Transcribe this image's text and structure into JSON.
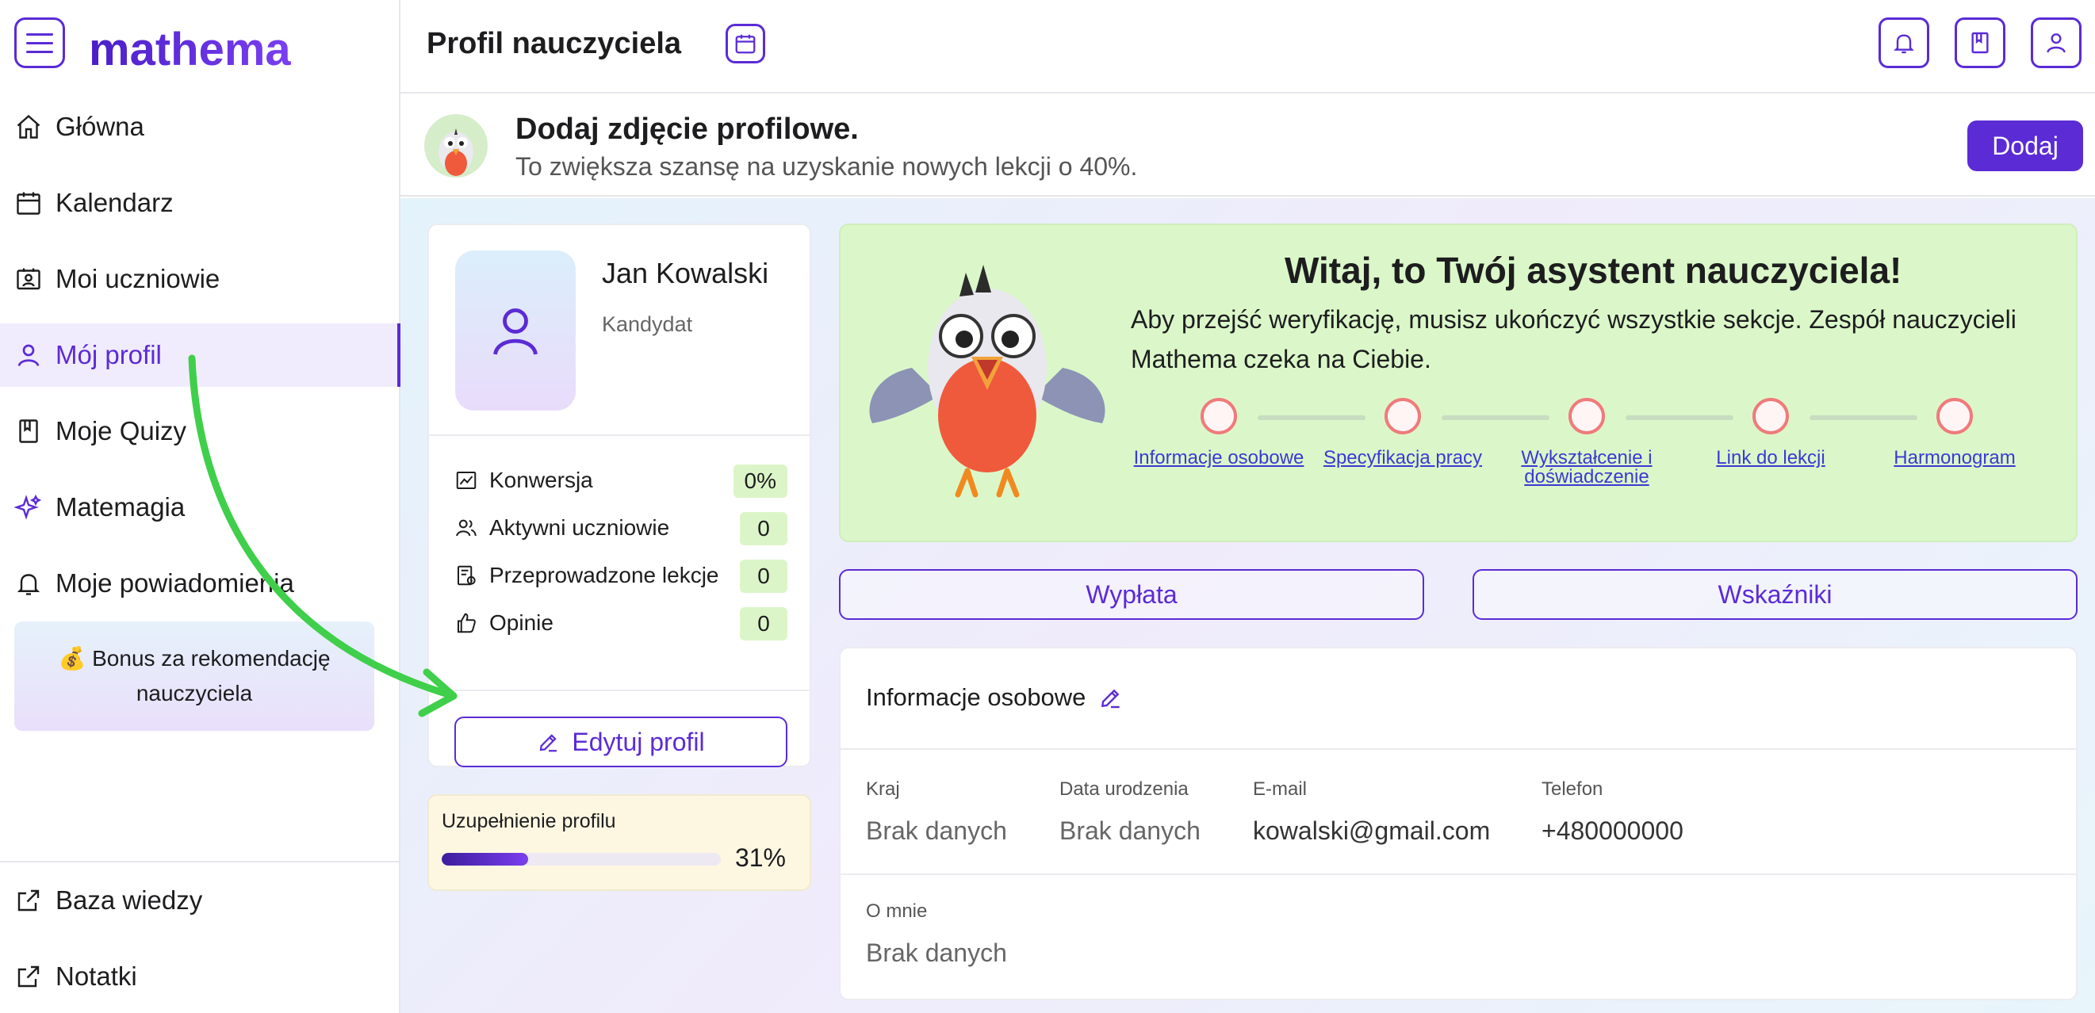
{
  "app": {
    "logo_text": "mathema"
  },
  "sidebar": {
    "items": [
      {
        "label": "Główna",
        "icon": "home-icon"
      },
      {
        "label": "Kalendarz",
        "icon": "calendar-icon"
      },
      {
        "label": "Moi uczniowie",
        "icon": "students-icon"
      },
      {
        "label": "Mój profil",
        "icon": "user-icon",
        "active": true
      },
      {
        "label": "Moje Quizy",
        "icon": "bookmark-icon"
      },
      {
        "label": "Matemagia",
        "icon": "sparkle-icon"
      },
      {
        "label": "Moje powiadomienia",
        "icon": "bell-icon"
      }
    ],
    "bonus": {
      "emoji": "💰",
      "line1": "Bonus za rekomendację",
      "line2": "nauczyciela"
    },
    "bottom_items": [
      {
        "label": "Baza wiedzy",
        "icon": "external-link-icon"
      },
      {
        "label": "Notatki",
        "icon": "external-link-icon"
      }
    ]
  },
  "header": {
    "title": "Profil nauczyciela"
  },
  "banner": {
    "title": "Dodaj zdjęcie profilowe.",
    "subtitle": "To zwiększa szansę na uzyskanie nowych lekcji o 40%.",
    "button": "Dodaj"
  },
  "profile": {
    "name": "Jan Kowalski",
    "role": "Kandydat",
    "stats": [
      {
        "label": "Konwersja",
        "value": "0%",
        "icon": "chart-icon"
      },
      {
        "label": "Aktywni uczniowie",
        "value": "0",
        "icon": "users-icon"
      },
      {
        "label": "Przeprowadzone lekcje",
        "value": "0",
        "icon": "lesson-icon"
      },
      {
        "label": "Opinie",
        "value": "0",
        "icon": "thumbs-up-icon"
      }
    ],
    "edit_button": "Edytuj profil"
  },
  "completion": {
    "label": "Uzupełnienie profilu",
    "percent_text": "31%",
    "fraction": 0.31
  },
  "welcome": {
    "title": "Witaj, to Twój asystent nauczyciela!",
    "text": "Aby przejść weryfikację, musisz ukończyć wszystkie sekcje. Zespół nauczycieli Mathema czeka na Ciebie.",
    "steps": [
      {
        "label": "Informacje osobowe"
      },
      {
        "label": "Specyfikacja pracy"
      },
      {
        "label": "Wykształcenie i doświadczenie"
      },
      {
        "label": "Link do lekcji"
      },
      {
        "label": "Harmonogram"
      }
    ]
  },
  "actions": {
    "payout": "Wypłata",
    "indicators": "Wskaźniki"
  },
  "personal": {
    "title": "Informacje osobowe",
    "fields": [
      {
        "label": "Kraj",
        "value": "Brak danych"
      },
      {
        "label": "Data urodzenia",
        "value": "Brak danych"
      },
      {
        "label": "E-mail",
        "value": "kowalski@gmail.com"
      },
      {
        "label": "Telefon",
        "value": "+480000000"
      }
    ],
    "about": {
      "label": "O mnie",
      "value": "Brak danych"
    }
  },
  "colors": {
    "accent": "#5b2bd6",
    "welcome_bg": "#dbf7c9",
    "step_circle": "#f07a7a",
    "arrow": "#3fcf4a"
  }
}
